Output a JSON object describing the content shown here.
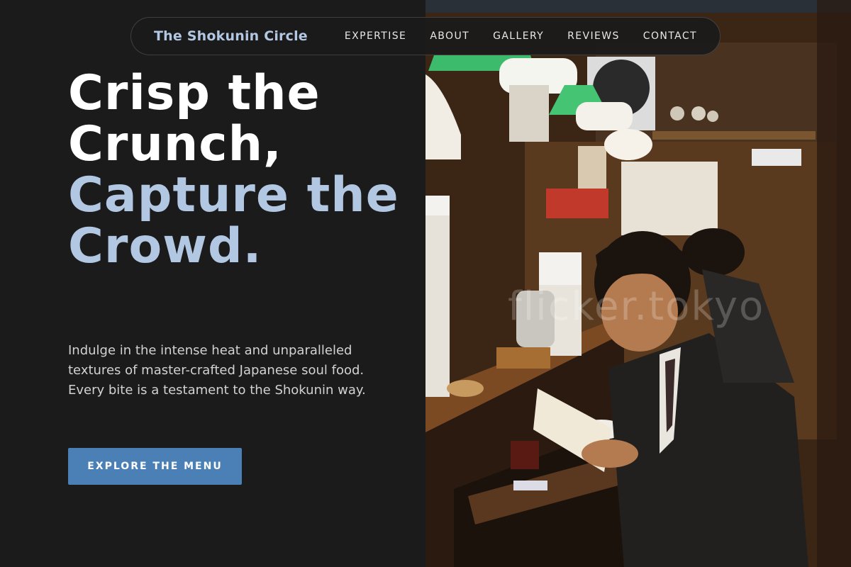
{
  "nav": {
    "brand": "The Shokunin Circle",
    "links": [
      "EXPERTISE",
      "ABOUT",
      "GALLERY",
      "REVIEWS",
      "CONTACT"
    ]
  },
  "hero": {
    "headline_white": "Crisp the Crunch,",
    "headline_accent": "Capture the Crowd.",
    "subtitle": "Indulge in the intense heat and unparalleled textures of master-crafted Japanese soul food. Every bite is a testament to the Shokunin way.",
    "cta_label": "EXPLORE THE MENU"
  },
  "photo": {
    "watermark": "flicker.tokyo"
  },
  "colors": {
    "background": "#1b1b1c",
    "accent": "#b2c7e2",
    "button": "#4a80b6"
  }
}
